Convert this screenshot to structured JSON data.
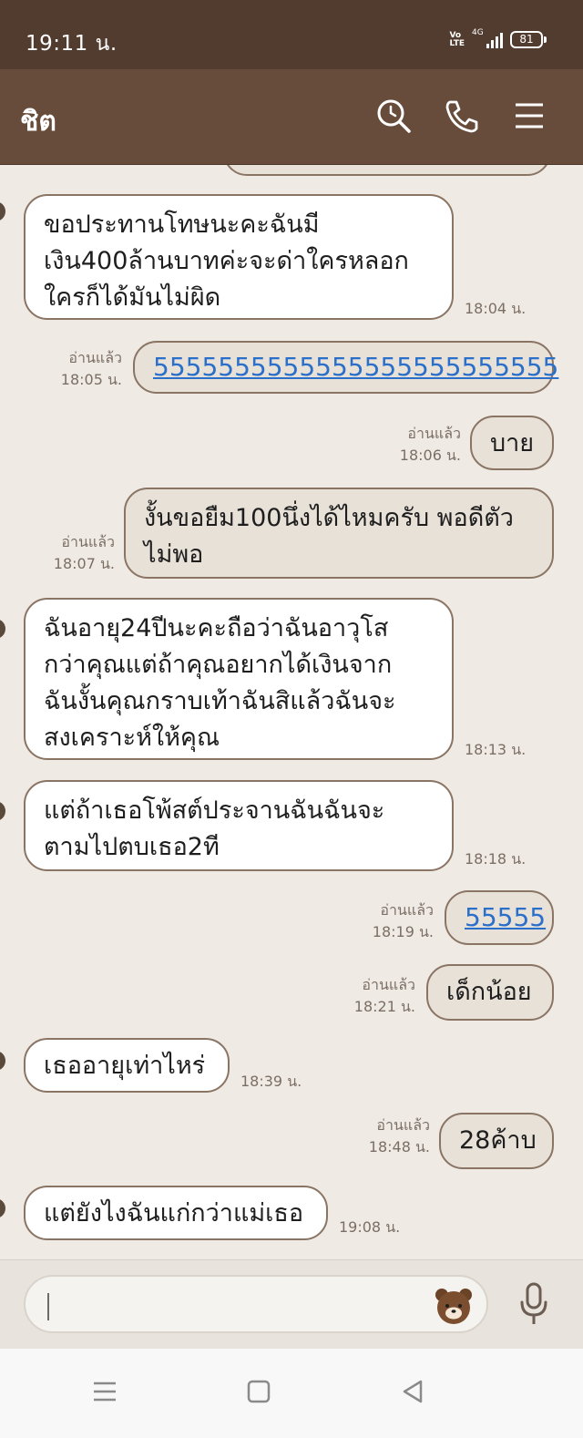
{
  "status": {
    "time": "19:11 น.",
    "volte_top": "Vo",
    "volte_bottom": "LTE",
    "network": "4G",
    "battery": "81"
  },
  "header": {
    "title": "ชิต",
    "search_icon": "search-icon",
    "call_icon": "phone-icon",
    "menu_icon": "hamburger-menu-icon"
  },
  "messages": [
    {
      "side": "in",
      "text": "ขอประทานโทษนะคะฉันมี\nเงิน400ล้านบาทค่ะจะด่าใครหลอก\nใครก็ได้มันไม่ผิด",
      "time": "18:04 น."
    },
    {
      "side": "out",
      "read": "อ่านแล้ว",
      "text": "5555555555555555555555555",
      "time": "18:05 น.",
      "link": true
    },
    {
      "side": "out",
      "read": "อ่านแล้ว",
      "text": "บาย",
      "time": "18:06 น."
    },
    {
      "side": "out",
      "read": "อ่านแล้ว",
      "text": "งั้นขอยืม100นึ่งได้ไหมครับ พอดีตัว\nไม่พอ",
      "time": "18:07 น."
    },
    {
      "side": "in",
      "text": "ฉันอายุ24ปีนะคะถือว่าฉันอาวุโส\nกว่าคุณแต่ถ้าคุณอยากได้เงินจาก\nฉันงั้นคุณกราบเท้าฉันสิแล้วฉันจะ\nสงเคราะห์ให้คุณ",
      "time": "18:13 น."
    },
    {
      "side": "in",
      "text": "แต่ถ้าเธอโพ้สต์ประจานฉันฉันจะ\nตามไปตบเธอ2ที",
      "time": "18:18 น."
    },
    {
      "side": "out",
      "read": "อ่านแล้ว",
      "text": "55555",
      "time": "18:19 น.",
      "link": true
    },
    {
      "side": "out",
      "read": "อ่านแล้ว",
      "text": "เด็กน้อย",
      "time": "18:21 น."
    },
    {
      "side": "in",
      "text": "เธออายุเท่าไหร่",
      "time": "18:39 น."
    },
    {
      "side": "out",
      "read": "อ่านแล้ว",
      "text": "28ค้าบ",
      "time": "18:48 น."
    },
    {
      "side": "in",
      "text": "แต่ยังไงฉันแก่กว่าแม่เธอ",
      "time": "19:08 น."
    }
  ],
  "composer": {
    "sticker_icon": "bear-sticker-icon",
    "mic_icon": "microphone-icon"
  },
  "navbar": {
    "menu_icon": "recent-apps-icon",
    "home_icon": "home-icon",
    "back_icon": "back-icon"
  },
  "colors": {
    "status_bar": "#523c2f",
    "header": "#684c3b",
    "chat_bg": "#efebe4",
    "bubble_in": "#ffffff",
    "bubble_out": "#e8e1d8",
    "bubble_border": "#8a7464",
    "link": "#2a6fc9"
  }
}
